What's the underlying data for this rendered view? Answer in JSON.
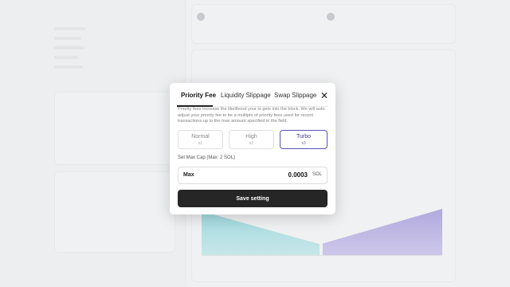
{
  "modal": {
    "tabs": [
      {
        "label": "Priority Fee",
        "active": true
      },
      {
        "label": "Liquidity Slippage",
        "active": false
      },
      {
        "label": "Swap Slippage",
        "active": false
      }
    ],
    "close_icon": "close-icon",
    "description": "Priority fees increase the likelihood your tx gets into the block. We will auto adjust your priority fee to be a multiple of priority fees used for recent transactions up to the max amount specified in the field.",
    "options": [
      {
        "name": "Normal",
        "multiplier": "x1",
        "selected": false
      },
      {
        "name": "High",
        "multiplier": "x2",
        "selected": false
      },
      {
        "name": "Turbo",
        "multiplier": "x3",
        "selected": true
      }
    ],
    "max_cap_label": "Set Max Cap (Max: 2 SOL)",
    "max_field": {
      "label": "Max",
      "value": "0.0003",
      "unit": "SOL"
    },
    "save_label": "Save setting"
  },
  "colors": {
    "accent": "#5a52b8",
    "button": "#262626"
  }
}
